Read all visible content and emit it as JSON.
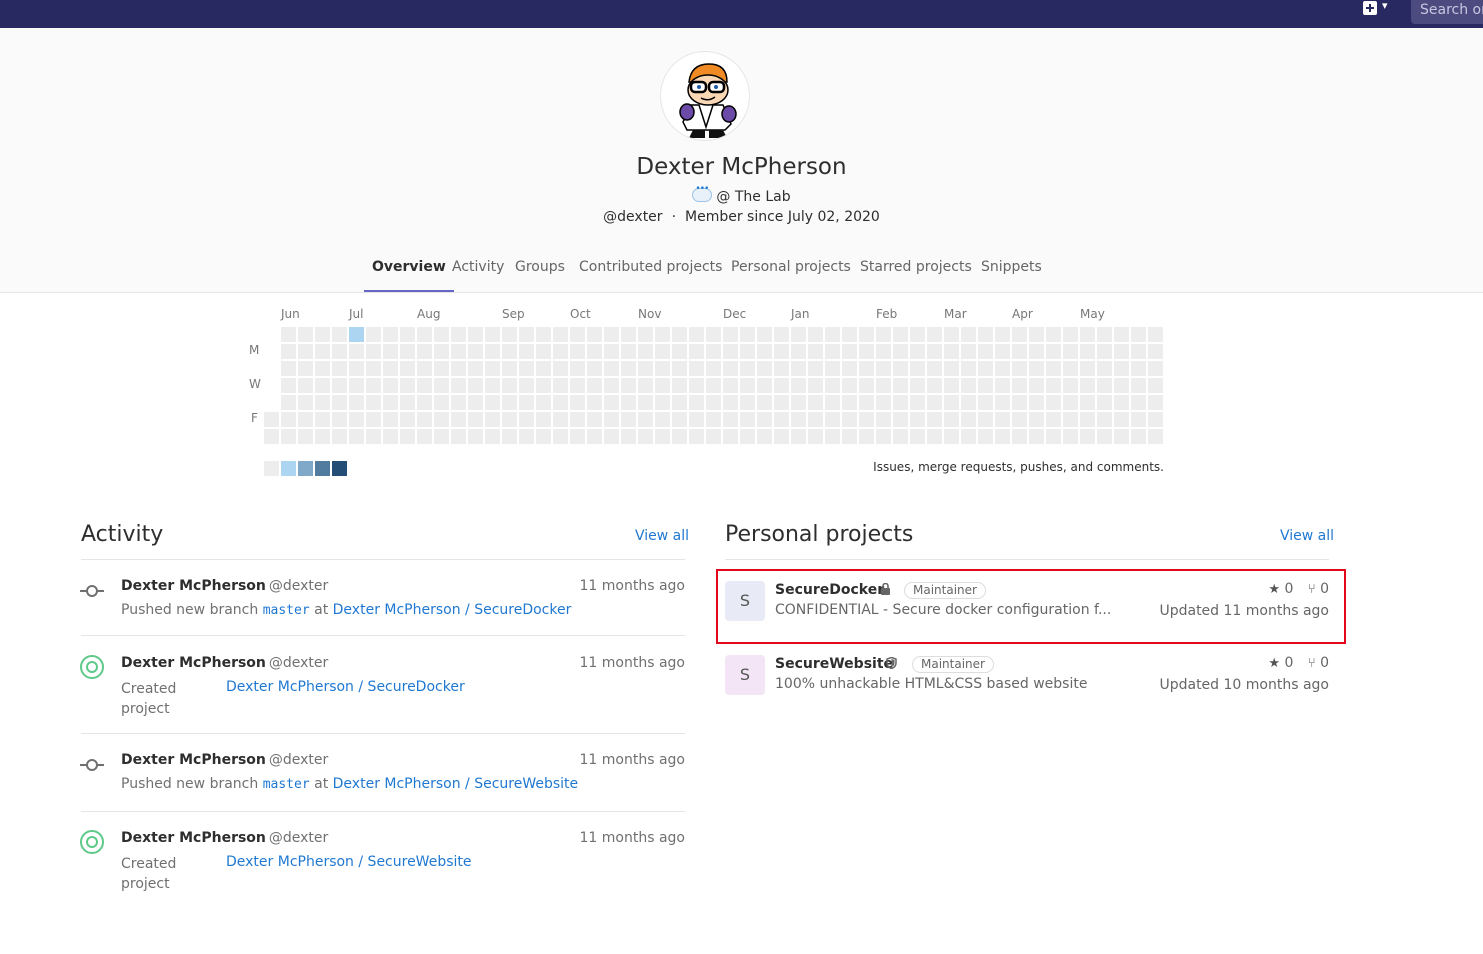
{
  "topbar": {
    "search_placeholder": "Search or jump to"
  },
  "profile": {
    "name": "Dexter McPherson",
    "status": "@ The Lab",
    "handle": "@dexter",
    "separator": "·",
    "member_since": "Member since July 02, 2020"
  },
  "tabs": [
    {
      "label": "Overview",
      "active": true
    },
    {
      "label": "Activity"
    },
    {
      "label": "Groups"
    },
    {
      "label": "Contributed projects"
    },
    {
      "label": "Personal projects"
    },
    {
      "label": "Starred projects"
    },
    {
      "label": "Snippets"
    }
  ],
  "calendar": {
    "months": [
      "Jun",
      "Jul",
      "Aug",
      "Sep",
      "Oct",
      "Nov",
      "Dec",
      "Jan",
      "Feb",
      "Mar",
      "Apr",
      "May"
    ],
    "days": [
      "M",
      "W",
      "F"
    ],
    "caption": "Issues, merge requests, pushes, and comments.",
    "colors": {
      "empty": "#ededed",
      "l1": "#acd5f2",
      "l2": "#7fa8c9",
      "l3": "#527ba0",
      "l4": "#254e77"
    }
  },
  "activity": {
    "title": "Activity",
    "view_all": "View all",
    "events": [
      {
        "author": "Dexter McPherson",
        "handle": "@dexter",
        "time": "11 months ago",
        "action": "Pushed new branch",
        "branch": "master",
        "at": "at",
        "target": "Dexter McPherson / SecureDocker",
        "type": "push"
      },
      {
        "author": "Dexter McPherson",
        "handle": "@dexter",
        "time": "11 months ago",
        "action": "Created project",
        "target": "Dexter McPherson / SecureDocker",
        "type": "create"
      },
      {
        "author": "Dexter McPherson",
        "handle": "@dexter",
        "time": "11 months ago",
        "action": "Pushed new branch",
        "branch": "master",
        "at": "at",
        "target": "Dexter McPherson / SecureWebsite",
        "type": "push"
      },
      {
        "author": "Dexter McPherson",
        "handle": "@dexter",
        "time": "11 months ago",
        "action": "Created project",
        "target": "Dexter McPherson / SecureWebsite",
        "type": "create"
      }
    ]
  },
  "projects": {
    "title": "Personal projects",
    "view_all": "View all",
    "items": [
      {
        "initial": "S",
        "name": "SecureDocker",
        "visibility": "lock-icon",
        "role": "Maintainer",
        "description": "CONFIDENTIAL - Secure docker configuration f...",
        "stars": "0",
        "forks": "0",
        "updated": "Updated 11 months ago",
        "avatar_bg": "#e8eaf6"
      },
      {
        "initial": "S",
        "name": "SecureWebsite",
        "visibility": "shield-icon",
        "role": "Maintainer",
        "description": "100% unhackable HTML&CSS based website",
        "stars": "0",
        "forks": "0",
        "updated": "Updated 10 months ago",
        "avatar_bg": "#f3e5f5"
      }
    ]
  },
  "colors": {
    "link": "#1f78d1",
    "topbar": "#292961",
    "highlight": "#e3071c"
  }
}
